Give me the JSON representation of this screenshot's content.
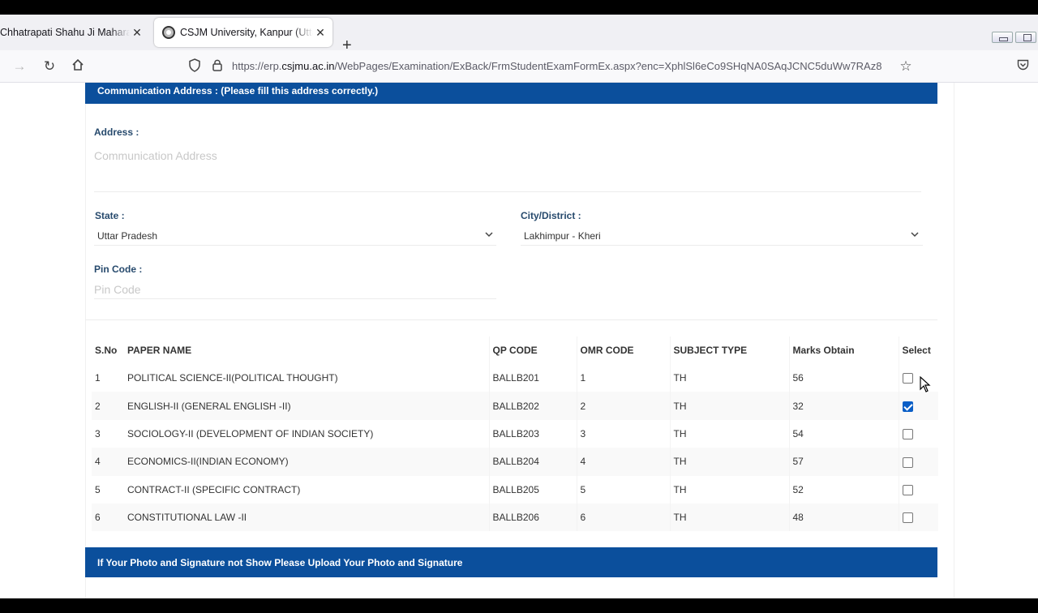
{
  "browser": {
    "tabs": [
      {
        "label": "Chhatrapati Shahu Ji Maharaj Uni",
        "active": false
      },
      {
        "label": "CSJM University, Kanpur (Uttar Pradesh)",
        "active": true
      }
    ],
    "url_prefix": "https://erp.",
    "url_domain": "csjmu.ac.in",
    "url_path": "/WebPages/Examination/ExBack/FrmStudentExamFormEx.aspx?enc=XphlSl6eCo9SHqNA0SAqJCNC5duWw7RAz8"
  },
  "form": {
    "comm_header": "Communication Address : (Please fill this address correctly.)",
    "address_label": "Address :",
    "address_placeholder": "Communication Address",
    "state_label": "State :",
    "state_value": "Uttar Pradesh",
    "city_label": "City/District :",
    "city_value": "Lakhimpur - Kheri",
    "pin_label": "Pin Code :",
    "pin_placeholder": "Pin Code",
    "photo_header": "If Your Photo and Signature not Show Please Upload Your Photo and Signature"
  },
  "table": {
    "headers": {
      "sno": "S.No",
      "paper": "PAPER NAME",
      "qp": "QP CODE",
      "omr": "OMR CODE",
      "type": "SUBJECT TYPE",
      "marks": "Marks Obtain",
      "select": "Select"
    },
    "rows": [
      {
        "sno": "1",
        "paper": "POLITICAL SCIENCE-II(POLITICAL THOUGHT)",
        "qp": "BALLB201",
        "omr": "1",
        "type": "TH",
        "marks": "56",
        "checked": false
      },
      {
        "sno": "2",
        "paper": "ENGLISH-II (GENERAL ENGLISH -II)",
        "qp": "BALLB202",
        "omr": "2",
        "type": "TH",
        "marks": "32",
        "checked": true
      },
      {
        "sno": "3",
        "paper": "SOCIOLOGY-II (DEVELOPMENT OF INDIAN SOCIETY)",
        "qp": "BALLB203",
        "omr": "3",
        "type": "TH",
        "marks": "54",
        "checked": false
      },
      {
        "sno": "4",
        "paper": "ECONOMICS-II(INDIAN ECONOMY)",
        "qp": "BALLB204",
        "omr": "4",
        "type": "TH",
        "marks": "57",
        "checked": false
      },
      {
        "sno": "5",
        "paper": "CONTRACT-II (SPECIFIC CONTRACT)",
        "qp": "BALLB205",
        "omr": "5",
        "type": "TH",
        "marks": "52",
        "checked": false
      },
      {
        "sno": "6",
        "paper": "CONSTITUTIONAL LAW -II",
        "qp": "BALLB206",
        "omr": "6",
        "type": "TH",
        "marks": "48",
        "checked": false
      }
    ]
  },
  "colors": {
    "header_blue": "#0b4f9c",
    "label_blue": "#274a6d",
    "checkbox_blue": "#0b5fc7"
  }
}
